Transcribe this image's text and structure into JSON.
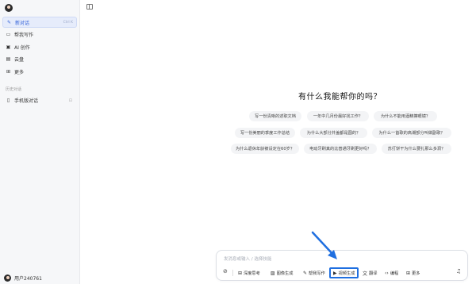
{
  "sidebar": {
    "items": [
      {
        "label": "新对话",
        "icon": "new-chat-icon",
        "shortcut": "Ctrl K",
        "active": true
      },
      {
        "label": "帮我写作",
        "icon": "writing-icon"
      },
      {
        "label": "AI 创作",
        "icon": "ai-creation-icon"
      },
      {
        "label": "云盘",
        "icon": "cloud-drive-icon"
      },
      {
        "label": "更多",
        "icon": "more-grid-icon"
      }
    ],
    "history_title": "历史对话",
    "history_items": [
      {
        "label": "手机版对话",
        "icon": "phone-icon"
      }
    ],
    "user_name": "用户240761"
  },
  "main": {
    "greeting": "有什么我能帮你的吗？",
    "suggestions": [
      "写一份清晰的述职文档",
      "一年中几月份最好找工作？",
      "为什么不能用酒精擦眼镜？",
      "写一份美丽的季度工作总结",
      "为什么大部分井盖都是圆的？",
      "为什么一首歌的高潮部分叫做副歌？",
      "为什么退休年龄被设定在60岁？",
      "电动牙刷真的比普通牙刷更好吗？",
      "苏打饼干为什么要扎那么多洞？"
    ]
  },
  "composer": {
    "placeholder": "发消息或输入 / 选择技能",
    "tools": [
      {
        "label": "深度思考",
        "icon": "deep-think-icon"
      },
      {
        "label": "图像生成",
        "icon": "image-gen-icon"
      },
      {
        "label": "帮我写作",
        "icon": "write-icon"
      },
      {
        "label": "视频生成",
        "icon": "video-gen-icon",
        "highlighted": true
      },
      {
        "label": "翻译",
        "icon": "translate-icon"
      },
      {
        "label": "编程",
        "icon": "code-icon"
      },
      {
        "label": "更多",
        "icon": "more-grid-icon"
      }
    ]
  },
  "colors": {
    "accent": "#2f5fd8",
    "highlight_box": "#1f6fe0",
    "sidebar_bg": "#f6f7f9",
    "chip_bg": "#f3f4f6"
  }
}
